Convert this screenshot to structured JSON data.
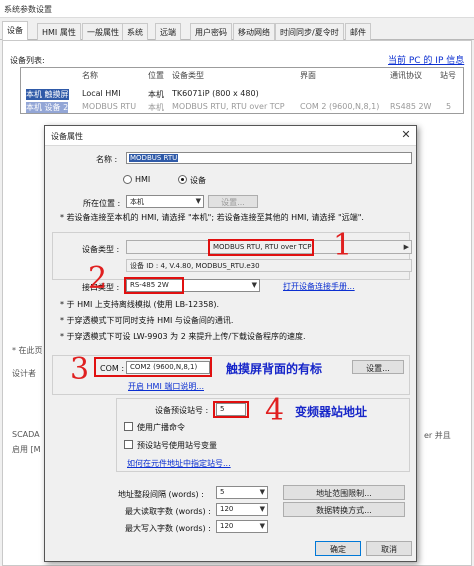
{
  "window": {
    "title": "系统参数设置"
  },
  "tabs": [
    "设备",
    "HMI 属性",
    "一般属性",
    "系统",
    "远端",
    "用户密码",
    "移动网络",
    "时间同步/夏令时",
    "邮件"
  ],
  "device_list": {
    "label": "设备列表:",
    "ip_link": "当前 PC 的 IP 信息",
    "headers": [
      "名称",
      "位置",
      "设备类型",
      "界面",
      "通讯协议",
      "站号"
    ],
    "rows": [
      [
        "本机 触摸屏",
        "Local HMI",
        "本机",
        "TK6071iP (800 x 480)",
        "",
        "",
        ""
      ],
      [
        "本机 设备 2",
        "MODBUS RTU",
        "本机",
        "MODBUS RTU, RTU over TCP",
        "COM 2 (9600,N,8,1)",
        "RS485 2W",
        "5"
      ]
    ]
  },
  "background": {
    "in_hint": "* 在此页",
    "designer": "设计者",
    "scada": "SCADA",
    "enable": "启用 [M",
    "er_and": "er 并且"
  },
  "dialog": {
    "title": "设备属性",
    "close": "✕",
    "name_label": "名称 :",
    "name_value": "MODBUS RTU",
    "radio_hmi": "HMI",
    "radio_device": "设备",
    "location_label": "所在位置 :",
    "location_value": "本机",
    "location_settings": "设置...",
    "location_note": "* 若设备连接至本机的 HMI, 请选择 \"本机\"; 若设备连接至其他的 HMI, 请选择 \"远端\".",
    "device_type_label": "设备类型 :",
    "device_type_value": "MODBUS RTU, RTU over TCP",
    "device_id": "设备 ID : 4, V.4.80, MODBUS_RTU.e30",
    "port_type_label": "接口类型 :",
    "port_type_value": "RS-485 2W",
    "port_manual_link": "打开设备连接手册...",
    "notes": [
      "* 于 HMI 上支持离线模拟 (使用 LB-12358).",
      "* 于穿透模式下可同时支持 HMI 与设备间的通讯.",
      "* 于穿透模式下可设 LW-9903 为 2 来提升上传/下载设备程序的速度."
    ],
    "com_label": "COM :",
    "com_value": "COM2 (9600,N,8,1)",
    "com_settings": "设置...",
    "open_hmi_link": "开启 HMI 端口说明...",
    "station_label": "设备预设站号 :",
    "station_value": "5",
    "broadcast_label": "使用广播命令",
    "station_var_label": "预设站号使用站号变量",
    "station_help_link": "如何在元件地址中指定站号...",
    "addr_interval_label": "地址整段间隔 (words) :",
    "addr_interval_value": "5",
    "addr_range_btn": "地址范围限制...",
    "max_read_label": "最大读取字数 (words) :",
    "max_read_value": "120",
    "data_convert_btn": "数据转换方式...",
    "max_write_label": "最大写入字数 (words) :",
    "max_write_value": "120",
    "ok": "确定",
    "cancel": "取消"
  },
  "annotations": {
    "n1": "1",
    "n2": "2",
    "n3": "3",
    "n4": "4",
    "com_note": "触摸屏背面的有标",
    "station_note": "变频器站地址"
  },
  "colors": {
    "annotation_red": "#e01010",
    "annotation_blue": "#1726c9",
    "selection": "#2f5aa8",
    "link": "#0b2fd1"
  }
}
